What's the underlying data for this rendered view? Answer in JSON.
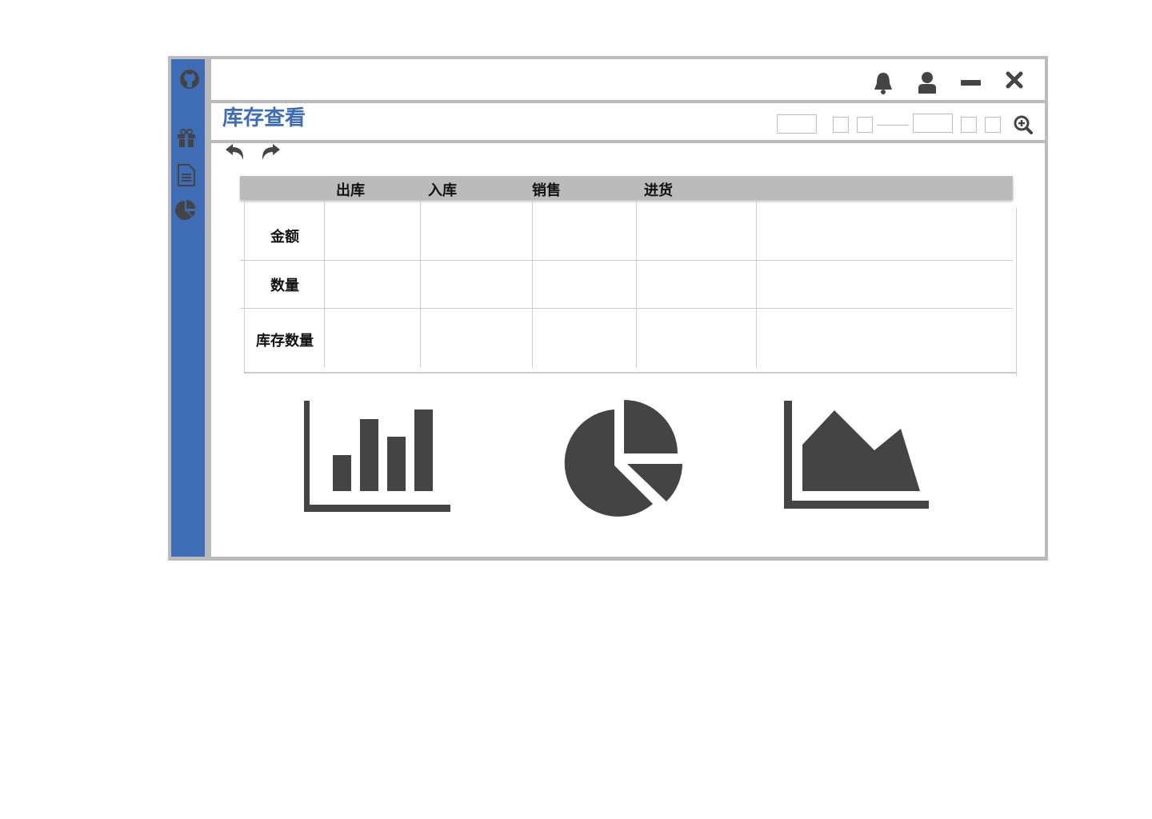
{
  "header": {
    "title": "库存查看"
  },
  "icons": {
    "sidebar": [
      "github-icon",
      "gift-icon",
      "document-icon",
      "pie-chart-icon"
    ],
    "topbar": [
      "bell-icon",
      "user-icon",
      "minimize-icon",
      "close-icon"
    ],
    "toolbar": [
      "undo-icon",
      "redo-icon",
      "zoom-in-icon"
    ]
  },
  "table": {
    "columns": [
      "出库",
      "入库",
      "销售",
      "进货"
    ],
    "rows": [
      "金额",
      "数量",
      "库存数量"
    ]
  },
  "colors": {
    "accent": "#3f6db5",
    "frame": "#bbbbbb",
    "icon": "#444444"
  }
}
